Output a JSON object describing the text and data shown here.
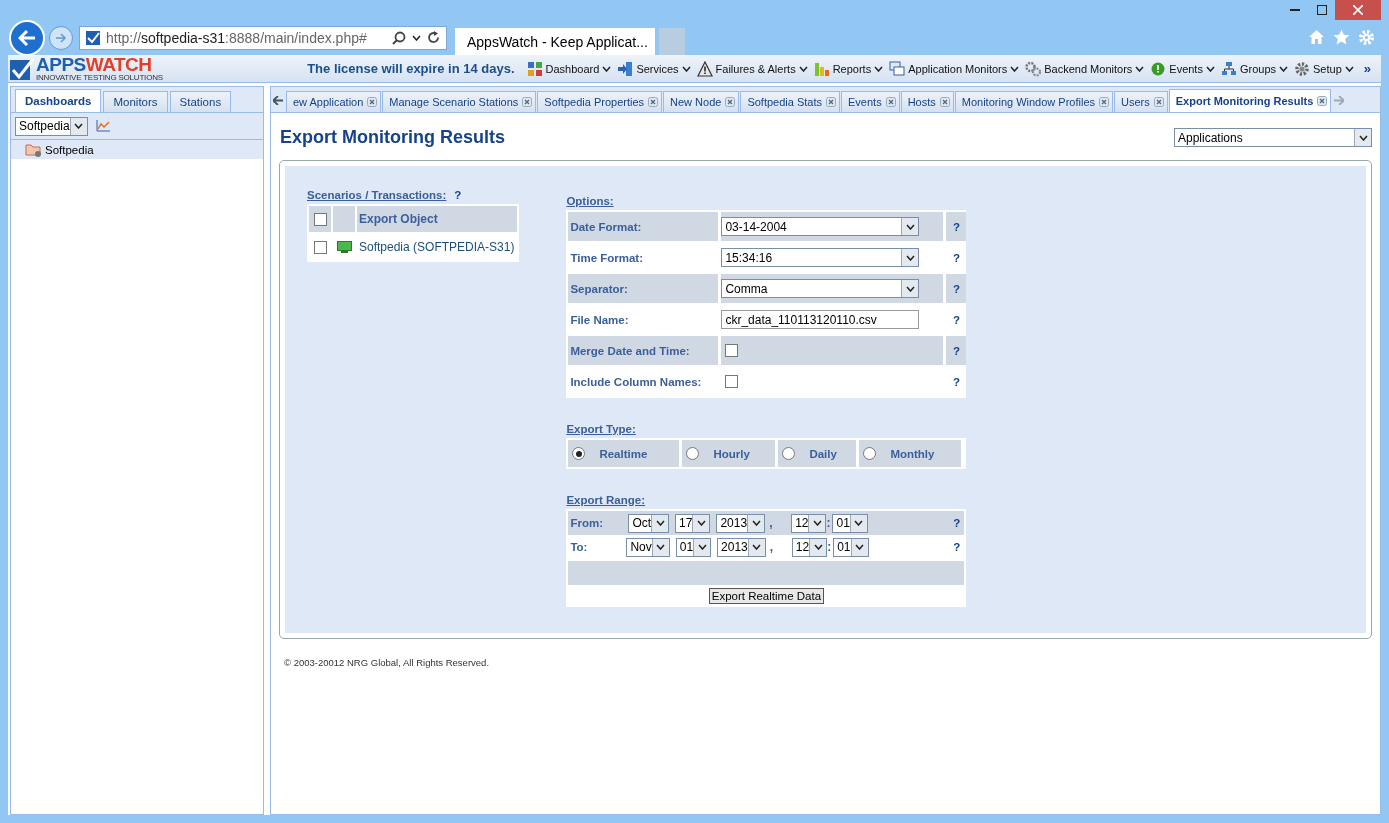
{
  "browser": {
    "address_scheme": "http://",
    "address_host": "softpedia-s31",
    "address_path": ":8888/main/index.php#",
    "tab_title": "AppsWatch - Keep Applicat..."
  },
  "header": {
    "logo_first": "APPS",
    "logo_second": "WATCH",
    "tagline": "INNOVATIVE TESTING SOLUTIONS",
    "notice": "The license will expire in 14 days.",
    "menu": [
      {
        "label": "Dashboard"
      },
      {
        "label": "Services"
      },
      {
        "label": "Failures & Alerts"
      },
      {
        "label": "Reports"
      },
      {
        "label": "Application Monitors"
      },
      {
        "label": "Backend Monitors"
      },
      {
        "label": "Events"
      },
      {
        "label": "Groups"
      },
      {
        "label": "Setup"
      }
    ],
    "overflow": "»"
  },
  "sidebar": {
    "tabs": [
      {
        "label": "Dashboards",
        "selected": true
      },
      {
        "label": "Monitors",
        "selected": false
      },
      {
        "label": "Stations",
        "selected": false
      }
    ],
    "dashboard_select": "Softpedia",
    "tree": [
      {
        "label": "Softpedia",
        "selected": true
      }
    ]
  },
  "tabs": [
    {
      "label": "ew Application",
      "selected": false
    },
    {
      "label": "Manage Scenario Stations",
      "selected": false
    },
    {
      "label": "Softpedia Properties",
      "selected": false
    },
    {
      "label": "New Node",
      "selected": false
    },
    {
      "label": "Softpedia Stats",
      "selected": false
    },
    {
      "label": "Events",
      "selected": false
    },
    {
      "label": "Hosts",
      "selected": false
    },
    {
      "label": "Monitoring Window Profiles",
      "selected": false
    },
    {
      "label": "Users",
      "selected": false
    },
    {
      "label": "Export Monitoring Results",
      "selected": true
    }
  ],
  "page": {
    "title": "Export Monitoring Results",
    "view_select": "Applications",
    "scenarios": {
      "heading": "Scenarios / Transactions:",
      "help": "?",
      "all_checked": false,
      "column": "Export Object",
      "rows": [
        {
          "label": "Softpedia (SOFTPEDIA-S31)",
          "checked": false
        }
      ]
    },
    "options": {
      "heading": "Options:",
      "rows": [
        {
          "kind": "select",
          "label": "Date Format:",
          "value": "03-14-2004",
          "help": "?"
        },
        {
          "kind": "select",
          "label": "Time Format:",
          "value": "15:34:16",
          "help": "?"
        },
        {
          "kind": "select",
          "label": "Separator:",
          "value": "Comma",
          "help": "?"
        },
        {
          "kind": "text",
          "label": "File Name:",
          "value": "ckr_data_110113120110.csv",
          "help": "?"
        },
        {
          "kind": "checkbox",
          "label": "Merge Date and Time:",
          "checked": false,
          "help": "?"
        },
        {
          "kind": "checkbox",
          "label": "Include Column Names:",
          "checked": false,
          "help": "?"
        }
      ]
    },
    "export_type": {
      "heading": "Export Type:",
      "options": [
        {
          "label": "Realtime",
          "selected": true
        },
        {
          "label": "Hourly",
          "selected": false
        },
        {
          "label": "Daily",
          "selected": false
        },
        {
          "label": "Monthly",
          "selected": false
        }
      ]
    },
    "export_range": {
      "heading": "Export Range:",
      "rows": [
        {
          "label": "From:",
          "month": "Oct",
          "day": "17",
          "year": "2013",
          "date_sep": ",",
          "hour": "12",
          "time_sep": ":",
          "minute": "01",
          "help": "?"
        },
        {
          "label": "To:",
          "month": "Nov",
          "day": "01",
          "year": "2013",
          "date_sep": ",",
          "hour": "12",
          "time_sep": ":",
          "minute": "01",
          "help": "?"
        }
      ]
    },
    "export_button": "Export Realtime Data"
  },
  "footer": "© 2003-20012 NRG Global, All Rights Reserved."
}
